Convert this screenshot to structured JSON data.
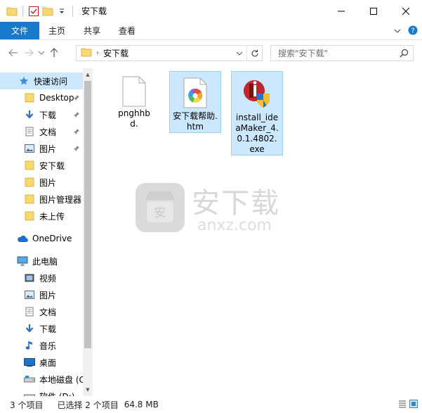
{
  "window": {
    "title": "安下载",
    "qat_dropdown": "=",
    "controls": [
      "minimize",
      "maximize",
      "close"
    ]
  },
  "ribbon": {
    "tabs": [
      "文件",
      "主页",
      "共享",
      "查看"
    ]
  },
  "address": {
    "path": "安下载",
    "search_placeholder": "搜索\"安下载\""
  },
  "nav": {
    "items": [
      {
        "label": "快速访问",
        "icon": "star-icon",
        "selected": true,
        "pinned": false
      },
      {
        "label": "Desktop",
        "icon": "folder-icon",
        "pinned": true
      },
      {
        "label": "下载",
        "icon": "download-arrow-icon",
        "pinned": true
      },
      {
        "label": "文档",
        "icon": "document-icon",
        "pinned": true
      },
      {
        "label": "图片",
        "icon": "picture-icon",
        "pinned": true
      },
      {
        "label": "安下载",
        "icon": "folder-icon"
      },
      {
        "label": "图片",
        "icon": "folder-icon"
      },
      {
        "label": "图片管理器",
        "icon": "folder-icon"
      },
      {
        "label": "未上传",
        "icon": "folder-icon"
      },
      {
        "label": "OneDrive",
        "icon": "cloud-icon"
      },
      {
        "label": "此电脑",
        "icon": "computer-icon"
      },
      {
        "label": "视频",
        "icon": "video-icon"
      },
      {
        "label": "图片",
        "icon": "picture-icon"
      },
      {
        "label": "文档",
        "icon": "document-icon"
      },
      {
        "label": "下载",
        "icon": "download-arrow-icon"
      },
      {
        "label": "音乐",
        "icon": "music-icon"
      },
      {
        "label": "桌面",
        "icon": "desktop-icon"
      },
      {
        "label": "本地磁盘 (C",
        "icon": "drive-icon"
      },
      {
        "label": "软件 (D:)",
        "icon": "drive-icon"
      }
    ]
  },
  "files": [
    {
      "name": "pnghhbd.",
      "icon": "blank-file-icon",
      "selected": false
    },
    {
      "name": "安下载帮助.htm",
      "icon": "htm-file-icon",
      "selected": true
    },
    {
      "name": "install_ideaMaker_4.0.1.4802.exe",
      "icon": "installer-exe-icon",
      "selected": true
    }
  ],
  "watermark": {
    "text": "安下载",
    "subtext": "anxz.com"
  },
  "status": {
    "count": "3 个项目",
    "selected": "已选择 2 个项目",
    "size": "64.8 MB"
  },
  "colors": {
    "accent": "#1979ca",
    "selection": "#cce8ff",
    "selection_border": "#99d1ff"
  }
}
